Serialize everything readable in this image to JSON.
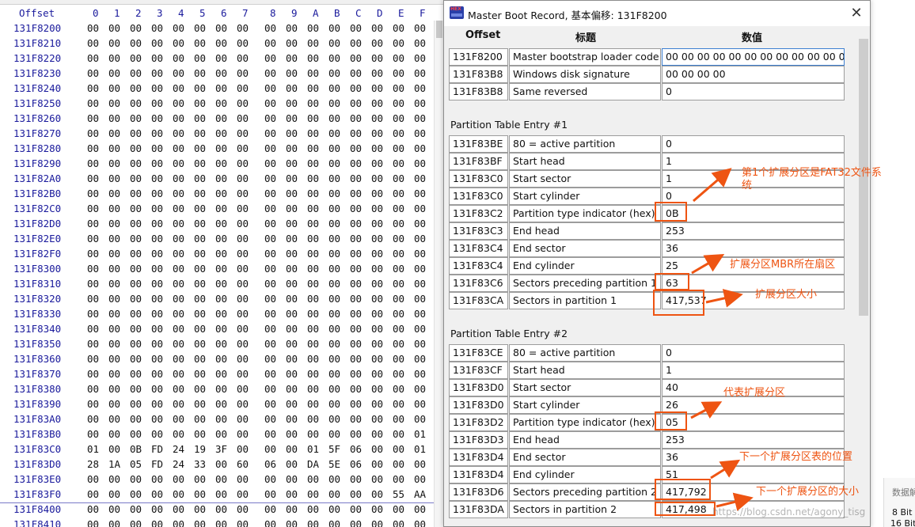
{
  "hex_editor": {
    "offset_header": "Offset",
    "column_headers": [
      "0",
      "1",
      "2",
      "3",
      "4",
      "5",
      "6",
      "7",
      "8",
      "9",
      "A",
      "B",
      "C",
      "D",
      "E",
      "F"
    ],
    "rows": [
      {
        "offset": "131F8200",
        "bytes": [
          "00",
          "00",
          "00",
          "00",
          "00",
          "00",
          "00",
          "00",
          "00",
          "00",
          "00",
          "00",
          "00",
          "00",
          "00",
          "00"
        ]
      },
      {
        "offset": "131F8210",
        "bytes": [
          "00",
          "00",
          "00",
          "00",
          "00",
          "00",
          "00",
          "00",
          "00",
          "00",
          "00",
          "00",
          "00",
          "00",
          "00",
          "00"
        ]
      },
      {
        "offset": "131F8220",
        "bytes": [
          "00",
          "00",
          "00",
          "00",
          "00",
          "00",
          "00",
          "00",
          "00",
          "00",
          "00",
          "00",
          "00",
          "00",
          "00",
          "00"
        ]
      },
      {
        "offset": "131F8230",
        "bytes": [
          "00",
          "00",
          "00",
          "00",
          "00",
          "00",
          "00",
          "00",
          "00",
          "00",
          "00",
          "00",
          "00",
          "00",
          "00",
          "00"
        ]
      },
      {
        "offset": "131F8240",
        "bytes": [
          "00",
          "00",
          "00",
          "00",
          "00",
          "00",
          "00",
          "00",
          "00",
          "00",
          "00",
          "00",
          "00",
          "00",
          "00",
          "00"
        ]
      },
      {
        "offset": "131F8250",
        "bytes": [
          "00",
          "00",
          "00",
          "00",
          "00",
          "00",
          "00",
          "00",
          "00",
          "00",
          "00",
          "00",
          "00",
          "00",
          "00",
          "00"
        ]
      },
      {
        "offset": "131F8260",
        "bytes": [
          "00",
          "00",
          "00",
          "00",
          "00",
          "00",
          "00",
          "00",
          "00",
          "00",
          "00",
          "00",
          "00",
          "00",
          "00",
          "00"
        ]
      },
      {
        "offset": "131F8270",
        "bytes": [
          "00",
          "00",
          "00",
          "00",
          "00",
          "00",
          "00",
          "00",
          "00",
          "00",
          "00",
          "00",
          "00",
          "00",
          "00",
          "00"
        ]
      },
      {
        "offset": "131F8280",
        "bytes": [
          "00",
          "00",
          "00",
          "00",
          "00",
          "00",
          "00",
          "00",
          "00",
          "00",
          "00",
          "00",
          "00",
          "00",
          "00",
          "00"
        ]
      },
      {
        "offset": "131F8290",
        "bytes": [
          "00",
          "00",
          "00",
          "00",
          "00",
          "00",
          "00",
          "00",
          "00",
          "00",
          "00",
          "00",
          "00",
          "00",
          "00",
          "00"
        ]
      },
      {
        "offset": "131F82A0",
        "bytes": [
          "00",
          "00",
          "00",
          "00",
          "00",
          "00",
          "00",
          "00",
          "00",
          "00",
          "00",
          "00",
          "00",
          "00",
          "00",
          "00"
        ]
      },
      {
        "offset": "131F82B0",
        "bytes": [
          "00",
          "00",
          "00",
          "00",
          "00",
          "00",
          "00",
          "00",
          "00",
          "00",
          "00",
          "00",
          "00",
          "00",
          "00",
          "00"
        ]
      },
      {
        "offset": "131F82C0",
        "bytes": [
          "00",
          "00",
          "00",
          "00",
          "00",
          "00",
          "00",
          "00",
          "00",
          "00",
          "00",
          "00",
          "00",
          "00",
          "00",
          "00"
        ]
      },
      {
        "offset": "131F82D0",
        "bytes": [
          "00",
          "00",
          "00",
          "00",
          "00",
          "00",
          "00",
          "00",
          "00",
          "00",
          "00",
          "00",
          "00",
          "00",
          "00",
          "00"
        ]
      },
      {
        "offset": "131F82E0",
        "bytes": [
          "00",
          "00",
          "00",
          "00",
          "00",
          "00",
          "00",
          "00",
          "00",
          "00",
          "00",
          "00",
          "00",
          "00",
          "00",
          "00"
        ]
      },
      {
        "offset": "131F82F0",
        "bytes": [
          "00",
          "00",
          "00",
          "00",
          "00",
          "00",
          "00",
          "00",
          "00",
          "00",
          "00",
          "00",
          "00",
          "00",
          "00",
          "00"
        ]
      },
      {
        "offset": "131F8300",
        "bytes": [
          "00",
          "00",
          "00",
          "00",
          "00",
          "00",
          "00",
          "00",
          "00",
          "00",
          "00",
          "00",
          "00",
          "00",
          "00",
          "00"
        ]
      },
      {
        "offset": "131F8310",
        "bytes": [
          "00",
          "00",
          "00",
          "00",
          "00",
          "00",
          "00",
          "00",
          "00",
          "00",
          "00",
          "00",
          "00",
          "00",
          "00",
          "00"
        ]
      },
      {
        "offset": "131F8320",
        "bytes": [
          "00",
          "00",
          "00",
          "00",
          "00",
          "00",
          "00",
          "00",
          "00",
          "00",
          "00",
          "00",
          "00",
          "00",
          "00",
          "00"
        ]
      },
      {
        "offset": "131F8330",
        "bytes": [
          "00",
          "00",
          "00",
          "00",
          "00",
          "00",
          "00",
          "00",
          "00",
          "00",
          "00",
          "00",
          "00",
          "00",
          "00",
          "00"
        ]
      },
      {
        "offset": "131F8340",
        "bytes": [
          "00",
          "00",
          "00",
          "00",
          "00",
          "00",
          "00",
          "00",
          "00",
          "00",
          "00",
          "00",
          "00",
          "00",
          "00",
          "00"
        ]
      },
      {
        "offset": "131F8350",
        "bytes": [
          "00",
          "00",
          "00",
          "00",
          "00",
          "00",
          "00",
          "00",
          "00",
          "00",
          "00",
          "00",
          "00",
          "00",
          "00",
          "00"
        ]
      },
      {
        "offset": "131F8360",
        "bytes": [
          "00",
          "00",
          "00",
          "00",
          "00",
          "00",
          "00",
          "00",
          "00",
          "00",
          "00",
          "00",
          "00",
          "00",
          "00",
          "00"
        ]
      },
      {
        "offset": "131F8370",
        "bytes": [
          "00",
          "00",
          "00",
          "00",
          "00",
          "00",
          "00",
          "00",
          "00",
          "00",
          "00",
          "00",
          "00",
          "00",
          "00",
          "00"
        ]
      },
      {
        "offset": "131F8380",
        "bytes": [
          "00",
          "00",
          "00",
          "00",
          "00",
          "00",
          "00",
          "00",
          "00",
          "00",
          "00",
          "00",
          "00",
          "00",
          "00",
          "00"
        ]
      },
      {
        "offset": "131F8390",
        "bytes": [
          "00",
          "00",
          "00",
          "00",
          "00",
          "00",
          "00",
          "00",
          "00",
          "00",
          "00",
          "00",
          "00",
          "00",
          "00",
          "00"
        ]
      },
      {
        "offset": "131F83A0",
        "bytes": [
          "00",
          "00",
          "00",
          "00",
          "00",
          "00",
          "00",
          "00",
          "00",
          "00",
          "00",
          "00",
          "00",
          "00",
          "00",
          "00"
        ]
      },
      {
        "offset": "131F83B0",
        "bytes": [
          "00",
          "00",
          "00",
          "00",
          "00",
          "00",
          "00",
          "00",
          "00",
          "00",
          "00",
          "00",
          "00",
          "00",
          "00",
          "01"
        ]
      },
      {
        "offset": "131F83C0",
        "bytes": [
          "01",
          "00",
          "0B",
          "FD",
          "24",
          "19",
          "3F",
          "00",
          "00",
          "00",
          "01",
          "5F",
          "06",
          "00",
          "00",
          "01"
        ]
      },
      {
        "offset": "131F83D0",
        "bytes": [
          "28",
          "1A",
          "05",
          "FD",
          "24",
          "33",
          "00",
          "60",
          "06",
          "00",
          "DA",
          "5E",
          "06",
          "00",
          "00",
          "00"
        ]
      },
      {
        "offset": "131F83E0",
        "bytes": [
          "00",
          "00",
          "00",
          "00",
          "00",
          "00",
          "00",
          "00",
          "00",
          "00",
          "00",
          "00",
          "00",
          "00",
          "00",
          "00"
        ]
      },
      {
        "offset": "131F83F0",
        "bytes": [
          "00",
          "00",
          "00",
          "00",
          "00",
          "00",
          "00",
          "00",
          "00",
          "00",
          "00",
          "00",
          "00",
          "00",
          "55",
          "AA"
        ]
      },
      {
        "offset": "131F8400",
        "bytes": [
          "00",
          "00",
          "00",
          "00",
          "00",
          "00",
          "00",
          "00",
          "00",
          "00",
          "00",
          "00",
          "00",
          "00",
          "00",
          "00"
        ]
      },
      {
        "offset": "131F8410",
        "bytes": [
          "00",
          "00",
          "00",
          "00",
          "00",
          "00",
          "00",
          "00",
          "00",
          "00",
          "00",
          "00",
          "00",
          "00",
          "00",
          "00"
        ]
      }
    ]
  },
  "dialog": {
    "title": "Master Boot Record, 基本偏移: 131F8200",
    "headers": {
      "offset": "Offset",
      "title": "标题",
      "value": "数值"
    },
    "top_rows": [
      {
        "offset": "131F8200",
        "label": "Master bootstrap loader code",
        "value": "00 00 00 00 00 00 00 00 00 00 00 00 00 0"
      },
      {
        "offset": "131F83B8",
        "label": "Windows disk signature",
        "value": "00 00 00 00"
      },
      {
        "offset": "131F83B8",
        "label": "Same reversed",
        "value": "0"
      }
    ],
    "sections": [
      {
        "title": "Partition Table Entry #1",
        "rows": [
          {
            "offset": "131F83BE",
            "label": "80 = active partition",
            "value": "0"
          },
          {
            "offset": "131F83BF",
            "label": "Start head",
            "value": "1"
          },
          {
            "offset": "131F83C0",
            "label": "Start sector",
            "value": "1"
          },
          {
            "offset": "131F83C0",
            "label": "Start cylinder",
            "value": "0"
          },
          {
            "offset": "131F83C2",
            "label": "Partition type indicator (hex)",
            "value": "0B"
          },
          {
            "offset": "131F83C3",
            "label": "End head",
            "value": "253"
          },
          {
            "offset": "131F83C4",
            "label": "End sector",
            "value": "36"
          },
          {
            "offset": "131F83C4",
            "label": "End cylinder",
            "value": "25"
          },
          {
            "offset": "131F83C6",
            "label": "Sectors preceding partition 1",
            "value": "63"
          },
          {
            "offset": "131F83CA",
            "label": "Sectors in partition 1",
            "value": "417,537"
          }
        ]
      },
      {
        "title": "Partition Table Entry #2",
        "rows": [
          {
            "offset": "131F83CE",
            "label": "80 = active partition",
            "value": "0"
          },
          {
            "offset": "131F83CF",
            "label": "Start head",
            "value": "1"
          },
          {
            "offset": "131F83D0",
            "label": "Start sector",
            "value": "40"
          },
          {
            "offset": "131F83D0",
            "label": "Start cylinder",
            "value": "26"
          },
          {
            "offset": "131F83D2",
            "label": "Partition type indicator (hex)",
            "value": "05"
          },
          {
            "offset": "131F83D3",
            "label": "End head",
            "value": "253"
          },
          {
            "offset": "131F83D4",
            "label": "End sector",
            "value": "36"
          },
          {
            "offset": "131F83D4",
            "label": "End cylinder",
            "value": "51"
          },
          {
            "offset": "131F83D6",
            "label": "Sectors preceding partition 2",
            "value": "417,792"
          },
          {
            "offset": "131F83DA",
            "label": "Sectors in partition 2",
            "value": "417,498"
          }
        ]
      }
    ]
  },
  "annotations": [
    {
      "text_line1": "第1个扩展分区是FAT32文件系",
      "text_line2": "统"
    },
    {
      "text_line1": "扩展分区MBR所在扇区"
    },
    {
      "text_line1": "扩展分区大小"
    },
    {
      "text_line1": "代表扩展分区"
    },
    {
      "text_line1": "下一个扩展分区表的位置"
    },
    {
      "text_line1": "下一个扩展分区的大小"
    }
  ],
  "annotation_color": "#ee5412",
  "side_panel": {
    "label": "数据解",
    "line1": "8 Bit",
    "line2": "16 Bit"
  },
  "watermark": "https://blog.csdn.net/agony_tisg"
}
